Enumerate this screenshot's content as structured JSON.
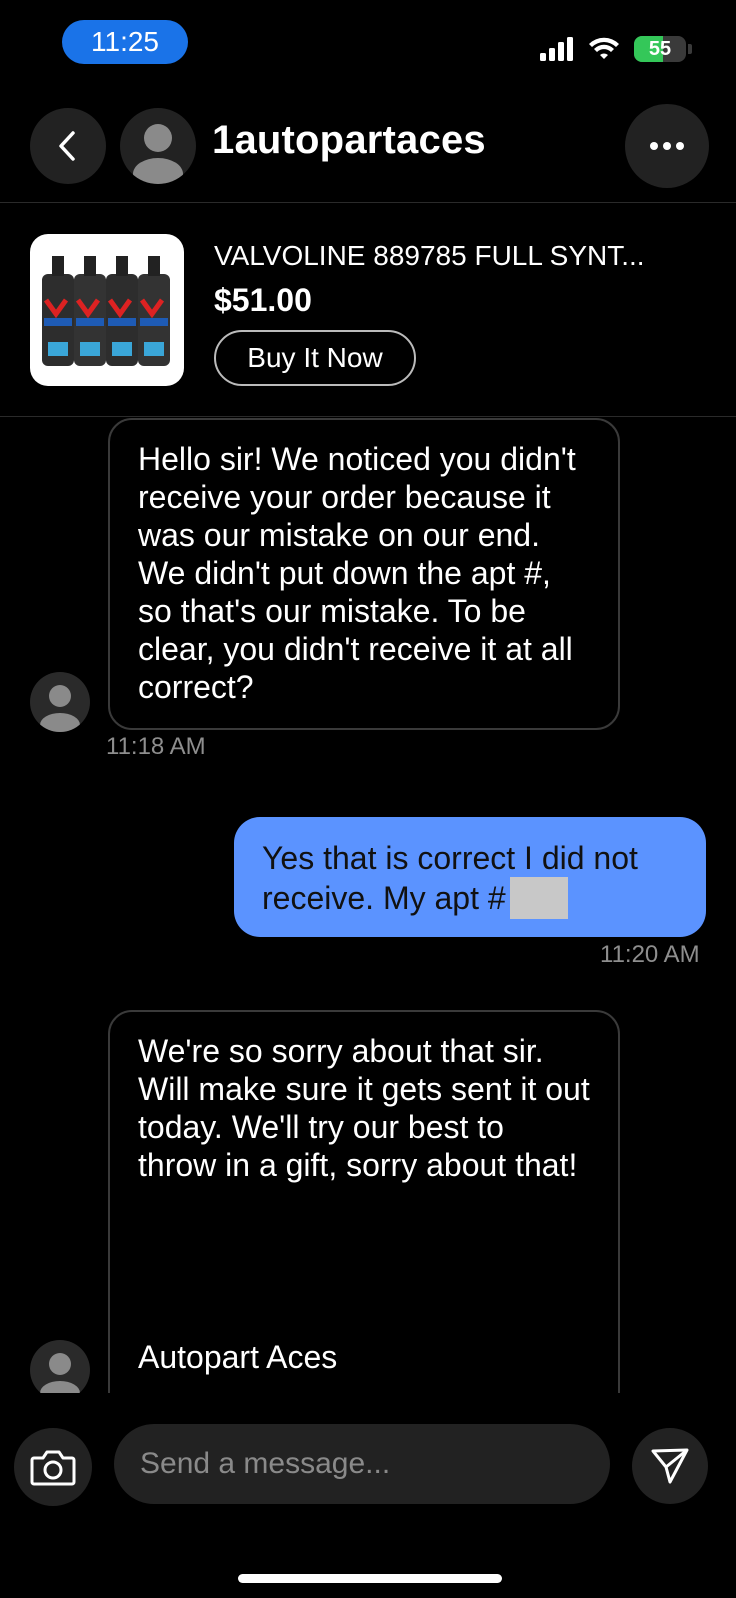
{
  "status_bar": {
    "time": "11:25",
    "battery": "55"
  },
  "header": {
    "username": "1autopartaces"
  },
  "product": {
    "title": "VALVOLINE 889785 FULL SYNT...",
    "price": "$51.00",
    "buy_label": "Buy It Now"
  },
  "messages": [
    {
      "direction": "incoming",
      "text": "Hello sir! We noticed you didn't receive your order because it was our mistake on our end. We didn't put down the apt #, so that's our mistake. To be clear, you didn't receive it at all correct?",
      "time": "11:18 AM"
    },
    {
      "direction": "outgoing",
      "text": "Yes that is correct I did not receive. My apt #",
      "time": "11:20 AM"
    },
    {
      "direction": "incoming",
      "text": "We're so sorry about that sir. Will make sure it gets sent it out today. We'll try our best to throw in a gift, sorry about that!",
      "signature": "Autopart Aces"
    }
  ],
  "composer": {
    "placeholder": "Send a message..."
  },
  "colors": {
    "outgoing_bubble": "#5b93ff",
    "time_pill": "#1a73e8",
    "battery": "#34c759"
  }
}
